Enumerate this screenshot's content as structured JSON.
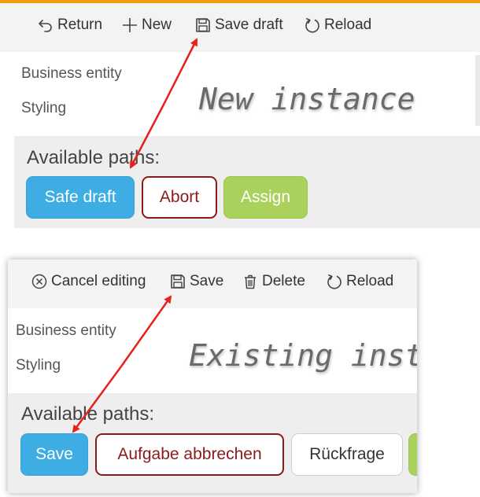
{
  "accent_colors": {
    "top_bar": "#f39c12",
    "primary_button": "#3eade3",
    "danger_outline": "#8b1a1a",
    "success_button": "#a9d15c",
    "arrow": "#e8201a"
  },
  "panel1": {
    "toolbar": {
      "return": {
        "label": "Return",
        "icon": "undo-arrow-icon"
      },
      "new": {
        "label": "New",
        "icon": "plus-icon"
      },
      "save_draft": {
        "label": "Save draft",
        "icon": "floppy-disk-icon"
      },
      "reload": {
        "label": "Reload",
        "icon": "reload-icon"
      }
    },
    "fields": [
      "Business entity",
      "Styling"
    ],
    "annotation": "New instance",
    "paths_title": "Available paths:",
    "path_buttons": [
      "Safe draft",
      "Abort",
      "Assign"
    ]
  },
  "panel2": {
    "toolbar": {
      "cancel_editing": {
        "label": "Cancel editing",
        "icon": "circle-x-icon"
      },
      "save": {
        "label": "Save",
        "icon": "floppy-disk-icon"
      },
      "delete": {
        "label": "Delete",
        "icon": "trash-icon"
      },
      "reload": {
        "label": "Reload",
        "icon": "reload-icon"
      }
    },
    "fields": [
      "Business entity",
      "Styling"
    ],
    "annotation": "Existing instance",
    "paths_title": "Available paths:",
    "path_buttons": [
      "Save",
      "Aufgabe abbrechen",
      "Rückfrage"
    ]
  }
}
